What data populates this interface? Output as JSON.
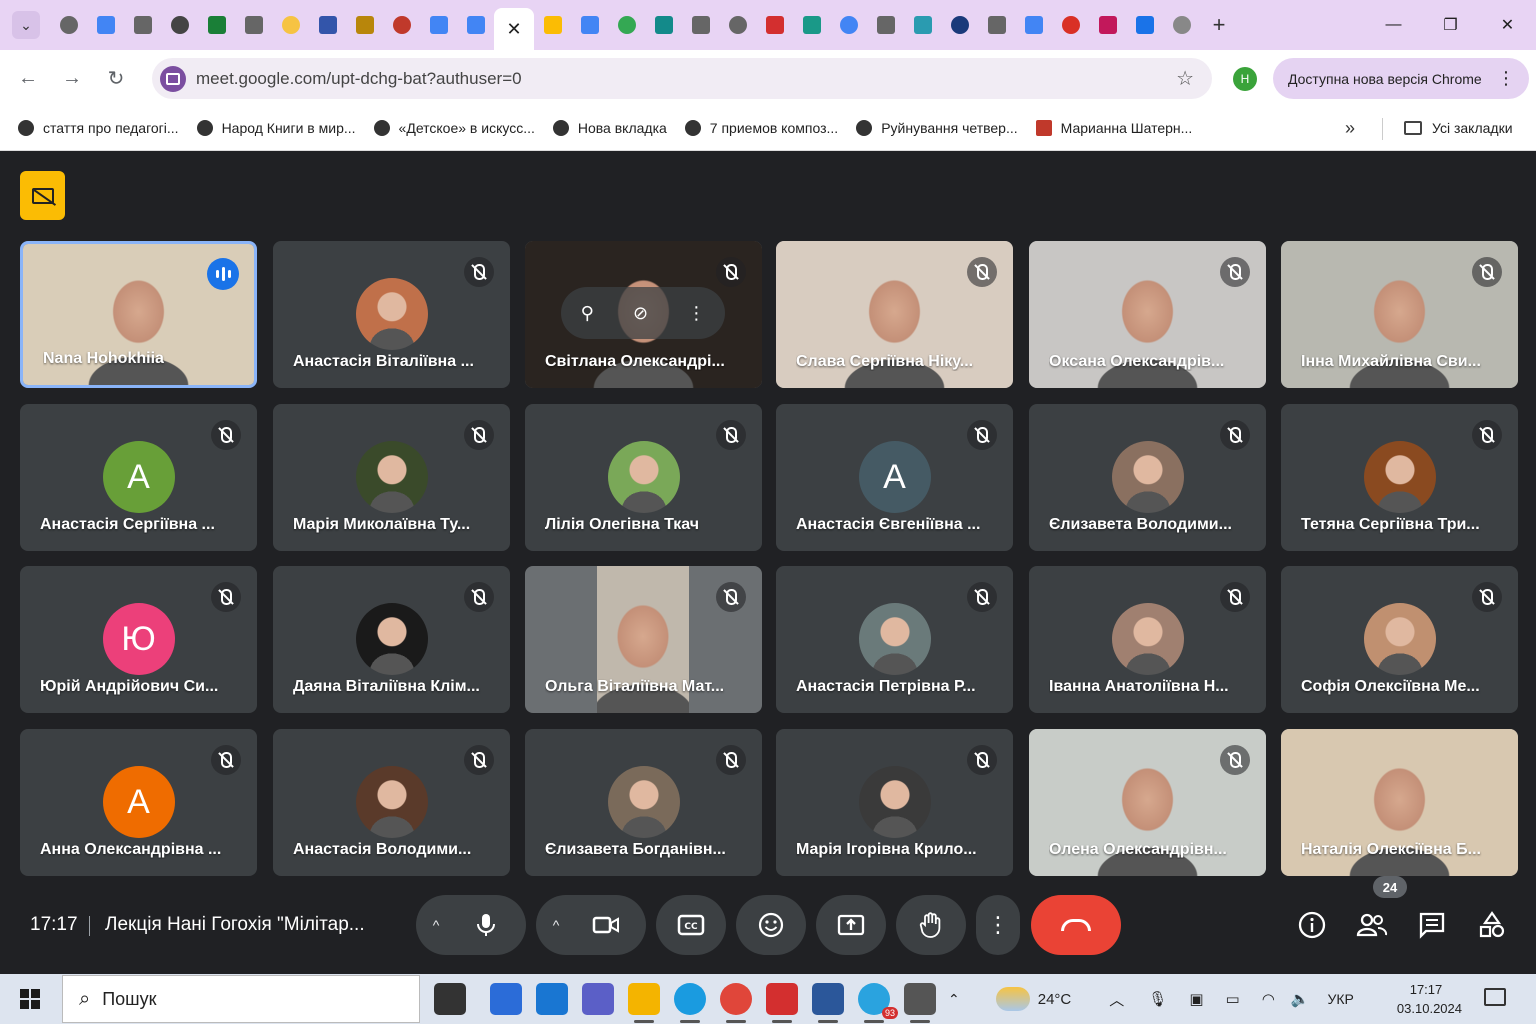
{
  "browser": {
    "tab_search_icon": "chevron-down-icon",
    "active_tab_close": "✕",
    "new_tab": "+",
    "window_controls": [
      "—",
      "❐",
      "✕"
    ],
    "tab_favicon_colors": [
      "#666",
      "#4285f4",
      "#666",
      "#444",
      "#1a7f37",
      "#666",
      "#f6c343",
      "#3355aa",
      "#b8860b",
      "#c0392b",
      "#4285f4",
      "#4285f4",
      "active",
      "#fbbc04",
      "#4285f4",
      "#34a853",
      "#138a8a",
      "#666",
      "#666",
      "#d32f2f",
      "#1a9988",
      "#4285f4",
      "#666",
      "#2a9bb0",
      "#1a3a7a",
      "#666",
      "#4285f4",
      "#d93025",
      "#c2185b",
      "#1a73e8",
      "#888"
    ],
    "url": "meet.google.com/upt-dchg-bat?authuser=0",
    "profile_initial": "H",
    "update_label": "Доступна нова версія Chrome",
    "bookmarks": [
      "стаття про педагогі...",
      "Народ Книги в мир...",
      "«Детское» в искусс...",
      "Нова вкладка",
      "7 приемов композ...",
      "Руйнування четвер...",
      "Марианна Шатерн..."
    ],
    "bookmarks_more": "»",
    "all_bookmarks": "Усі закладки"
  },
  "participants": [
    {
      "name": "Nana Hohokhiia",
      "type": "video",
      "speaking": true,
      "bg": "#d9cdb8"
    },
    {
      "name": "Анастасія Віталіївна ...",
      "type": "photo",
      "color": "#c0704a"
    },
    {
      "name": "Світлана Олександрі...",
      "type": "video",
      "bg": "#2a2420",
      "hover": true
    },
    {
      "name": "Слава Сергіївна Ніку...",
      "type": "video",
      "bg": "#d8ccc0"
    },
    {
      "name": "Оксана Олександрів...",
      "type": "video",
      "bg": "#c8c6c4"
    },
    {
      "name": "Інна Михайлівна Сви...",
      "type": "video",
      "bg": "#b8b8b0"
    },
    {
      "name": "Анастасія Сергіївна ...",
      "type": "letter",
      "letter": "A",
      "color": "#689f38"
    },
    {
      "name": "Марія Миколаївна Ту...",
      "type": "photo",
      "color": "#3a4a2a"
    },
    {
      "name": "Лілія Олегівна Ткач",
      "type": "photo",
      "color": "#7aa858"
    },
    {
      "name": "Анастасія Євгеніївна ...",
      "type": "letter",
      "letter": "A",
      "color": "#455a64"
    },
    {
      "name": "Єлизавета Володими...",
      "type": "photo",
      "color": "#8a7060"
    },
    {
      "name": "Тетяна Сергіївна Три...",
      "type": "photo",
      "color": "#8a4a20"
    },
    {
      "name": "Юрій Андрійович Си...",
      "type": "letter",
      "letter": "Ю",
      "color": "#ec407a"
    },
    {
      "name": "Даяна Віталіївна Клім...",
      "type": "photo",
      "color": "#1a1a1a"
    },
    {
      "name": "Ольга Віталіївна Мат...",
      "type": "video",
      "bg": "#c0b8ac",
      "narrow": true
    },
    {
      "name": "Анастасія Петрівна Р...",
      "type": "photo",
      "color": "#6a7a7a"
    },
    {
      "name": "Іванна Анатоліївна Н...",
      "type": "photo",
      "color": "#a08070"
    },
    {
      "name": "Софія Олексіївна Ме...",
      "type": "photo",
      "color": "#c09070"
    },
    {
      "name": "Анна Олександрівна ...",
      "type": "letter",
      "letter": "A",
      "color": "#ef6c00"
    },
    {
      "name": "Анастасія Володими...",
      "type": "photo",
      "color": "#5a3a2a"
    },
    {
      "name": "Єлизавета Богданівн...",
      "type": "photo",
      "color": "#7a6a5a"
    },
    {
      "name": "Марія Ігорівна Крило...",
      "type": "photo",
      "color": "#3a3a3a"
    },
    {
      "name": "Олена Олександрівн...",
      "type": "video",
      "bg": "#c8ccc8"
    },
    {
      "name": "Наталія Олексіївна Б...",
      "type": "video",
      "bg": "#d8c8b0",
      "nomute": true
    }
  ],
  "meeting": {
    "time": "17:17",
    "title": "Лекція Нані Гогохія \"Мілітар...",
    "participant_count": "24",
    "hover_controls": [
      "pin-icon",
      "mute-icon",
      "more-icon"
    ]
  },
  "controls": {
    "caret": "^",
    "mic_icon": "🎙",
    "camera_icon": "▭◁",
    "captions_icon": "CC",
    "emoji_icon": "☺",
    "present_icon": "⬆",
    "raise_hand_icon": "✋",
    "more_icon": "⋮",
    "info_icon": "ⓘ",
    "people_icon": "👥",
    "chat_icon": "▤",
    "activities_icon": "△"
  },
  "taskbar": {
    "search_placeholder": "Пошук",
    "apps": [
      {
        "name": "task-view",
        "color": "#333"
      },
      {
        "name": "store",
        "color": "#2b6cd8"
      },
      {
        "name": "mail",
        "color": "#1976d2"
      },
      {
        "name": "teams",
        "color": "#5b5fc7"
      },
      {
        "name": "explorer",
        "color": "#f4b400"
      },
      {
        "name": "edge",
        "color": "#1a9be0"
      },
      {
        "name": "chrome",
        "color": "#e0463a"
      },
      {
        "name": "acrobat",
        "color": "#d32f2f"
      },
      {
        "name": "word",
        "color": "#2b579a"
      },
      {
        "name": "telegram",
        "color": "#2aa3df"
      },
      {
        "name": "settings",
        "color": "#555"
      }
    ],
    "telegram_badge": "93",
    "weather": "24°C",
    "language": "УКР",
    "time": "17:17",
    "date": "03.10.2024"
  }
}
